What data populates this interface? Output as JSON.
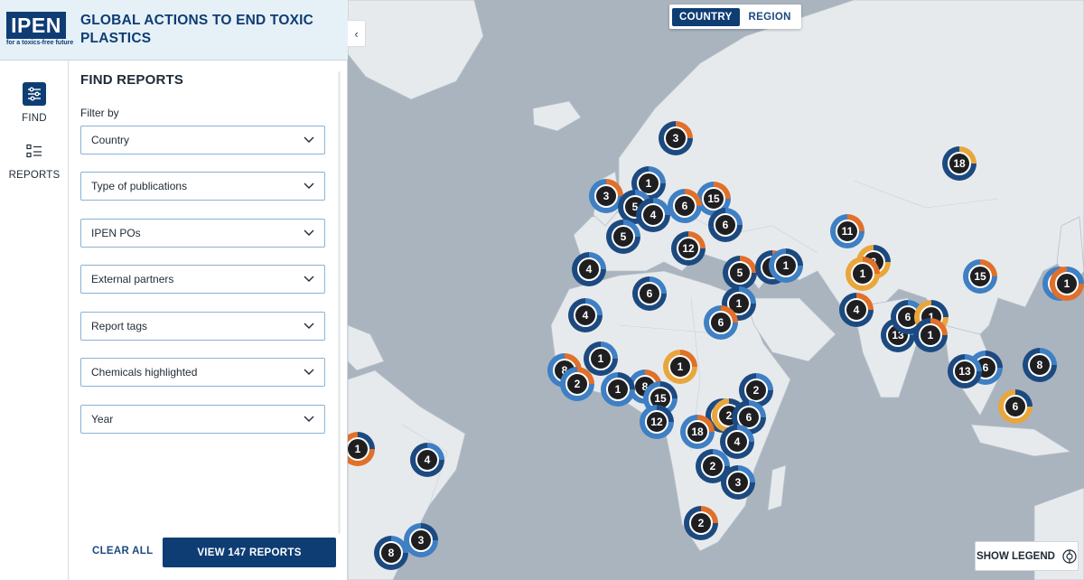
{
  "brand": {
    "logo_text": "IPEN",
    "tagline": "for a toxics-free future",
    "app_title": "GLOBAL ACTIONS TO END TOXIC PLASTICS",
    "colors": {
      "navy": "#0e3d74",
      "map_water": "#a9b4bf",
      "map_land": "#e7eaed"
    }
  },
  "rail": {
    "find_label": "FIND",
    "find_icon": "sliders-icon",
    "reports_label": "REPORTS",
    "reports_icon": "list-icon"
  },
  "panel": {
    "title": "FIND REPORTS",
    "filter_by": "Filter by",
    "filters": [
      {
        "label": "Country"
      },
      {
        "label": "Type of publications"
      },
      {
        "label": "IPEN POs"
      },
      {
        "label": "External partners"
      },
      {
        "label": "Report tags"
      },
      {
        "label": "Chemicals highlighted"
      },
      {
        "label": "Year"
      }
    ],
    "clear_all": "CLEAR ALL",
    "view_button": "VIEW 147 REPORTS"
  },
  "map": {
    "view_toggle": {
      "country": "COUNTRY",
      "region": "REGION",
      "selected": "COUNTRY"
    },
    "show_legend": "SHOW LEGEND",
    "collapse_icon": "chevron-left-icon",
    "clusters": [
      {
        "count": "3",
        "ring": "#1c4a80",
        "accent": "#e0702a"
      },
      {
        "count": "18",
        "ring": "#1c4a80",
        "accent": "#e8a63c"
      },
      {
        "count": "3",
        "ring": "#3f7fc4",
        "accent": "#e0702a"
      },
      {
        "count": "1",
        "ring": "#1c4a80",
        "accent": "#3f7fc4"
      },
      {
        "count": "15",
        "ring": "#3f7fc4",
        "accent": "#e0702a"
      },
      {
        "count": "5",
        "ring": "#1c4a80",
        "accent": "#3f7fc4"
      },
      {
        "count": "6",
        "ring": "#3f7fc4",
        "accent": "#e0702a"
      },
      {
        "count": "4",
        "ring": "#1c4a80",
        "accent": "#3f7fc4"
      },
      {
        "count": "6",
        "ring": "#1c4a80",
        "accent": "#3f7fc4"
      },
      {
        "count": "5",
        "ring": "#1c4a80",
        "accent": "#3f7fc4"
      },
      {
        "count": "12",
        "ring": "#1c4a80",
        "accent": "#e0702a"
      },
      {
        "count": "11",
        "ring": "#3f7fc4",
        "accent": "#e0702a"
      },
      {
        "count": "3",
        "ring": "#e8a63c",
        "accent": "#1c4a80"
      },
      {
        "count": "1",
        "ring": "#e8a63c",
        "accent": "#e0702a"
      },
      {
        "count": "4",
        "ring": "#1c4a80",
        "accent": "#3f7fc4"
      },
      {
        "count": "5",
        "ring": "#1c4a80",
        "accent": "#e0702a"
      },
      {
        "count": "8",
        "ring": "#1c4a80",
        "accent": "#e0702a"
      },
      {
        "count": "1",
        "ring": "#3f7fc4",
        "accent": "#1c4a80"
      },
      {
        "count": "15",
        "ring": "#3f7fc4",
        "accent": "#e0702a"
      },
      {
        "count": "1",
        "ring": "#3f7fc4",
        "accent": "#e0702a"
      },
      {
        "count": "6",
        "ring": "#1c4a80",
        "accent": "#3f7fc4"
      },
      {
        "count": "1",
        "ring": "#1c4a80",
        "accent": "#3f7fc4"
      },
      {
        "count": "4",
        "ring": "#1c4a80",
        "accent": "#3f7fc4"
      },
      {
        "count": "4",
        "ring": "#1c4a80",
        "accent": "#e0702a"
      },
      {
        "count": "6",
        "ring": "#3f7fc4",
        "accent": "#e0702a"
      },
      {
        "count": "13",
        "ring": "#1c4a80",
        "accent": "#3f7fc4"
      },
      {
        "count": "6",
        "ring": "#1c4a80",
        "accent": "#3f7fc4"
      },
      {
        "count": "1",
        "ring": "#e8a63c",
        "accent": "#1c4a80"
      },
      {
        "count": "1",
        "ring": "#1c4a80",
        "accent": "#e0702a"
      },
      {
        "count": "8",
        "ring": "#3f7fc4",
        "accent": "#e0702a"
      },
      {
        "count": "1",
        "ring": "#1c4a80",
        "accent": "#3f7fc4"
      },
      {
        "count": "1",
        "ring": "#e8a63c",
        "accent": "#e0702a"
      },
      {
        "count": "8",
        "ring": "#3f7fc4",
        "accent": "#e0702a"
      },
      {
        "count": "2",
        "ring": "#3f7fc4",
        "accent": "#e0702a"
      },
      {
        "count": "1",
        "ring": "#3f7fc4",
        "accent": "#1c4a80"
      },
      {
        "count": "8",
        "ring": "#1c4a80",
        "accent": "#3f7fc4"
      },
      {
        "count": "15",
        "ring": "#3f7fc4",
        "accent": "#1c4a80"
      },
      {
        "count": "2",
        "ring": "#1c4a80",
        "accent": "#3f7fc4"
      },
      {
        "count": "6",
        "ring": "#3f7fc4",
        "accent": "#1c4a80"
      },
      {
        "count": "2",
        "ring": "#1c4a80",
        "accent": "#3f7fc4"
      },
      {
        "count": "2",
        "ring": "#e8a63c",
        "accent": "#1c4a80"
      },
      {
        "count": "6",
        "ring": "#1c4a80",
        "accent": "#3f7fc4"
      },
      {
        "count": "12",
        "ring": "#3f7fc4",
        "accent": "#1c4a80"
      },
      {
        "count": "18",
        "ring": "#3f7fc4",
        "accent": "#e0702a"
      },
      {
        "count": "4",
        "ring": "#1c4a80",
        "accent": "#3f7fc4"
      },
      {
        "count": "13",
        "ring": "#1c4a80",
        "accent": "#3f7fc4"
      },
      {
        "count": "6",
        "ring": "#e8a63c",
        "accent": "#1c4a80"
      },
      {
        "count": "1",
        "ring": "#e0702a",
        "accent": "#1c4a80"
      },
      {
        "count": "4",
        "ring": "#1c4a80",
        "accent": "#3f7fc4"
      },
      {
        "count": "2",
        "ring": "#1c4a80",
        "accent": "#3f7fc4"
      },
      {
        "count": "3",
        "ring": "#1c4a80",
        "accent": "#3f7fc4"
      },
      {
        "count": "2",
        "ring": "#1c4a80",
        "accent": "#e0702a"
      },
      {
        "count": "8",
        "ring": "#1c4a80",
        "accent": "#3f7fc4"
      },
      {
        "count": "3",
        "ring": "#3f7fc4",
        "accent": "#1c4a80"
      },
      {
        "count": "1",
        "ring": "#e0702a",
        "accent": "#3f7fc4"
      }
    ]
  }
}
